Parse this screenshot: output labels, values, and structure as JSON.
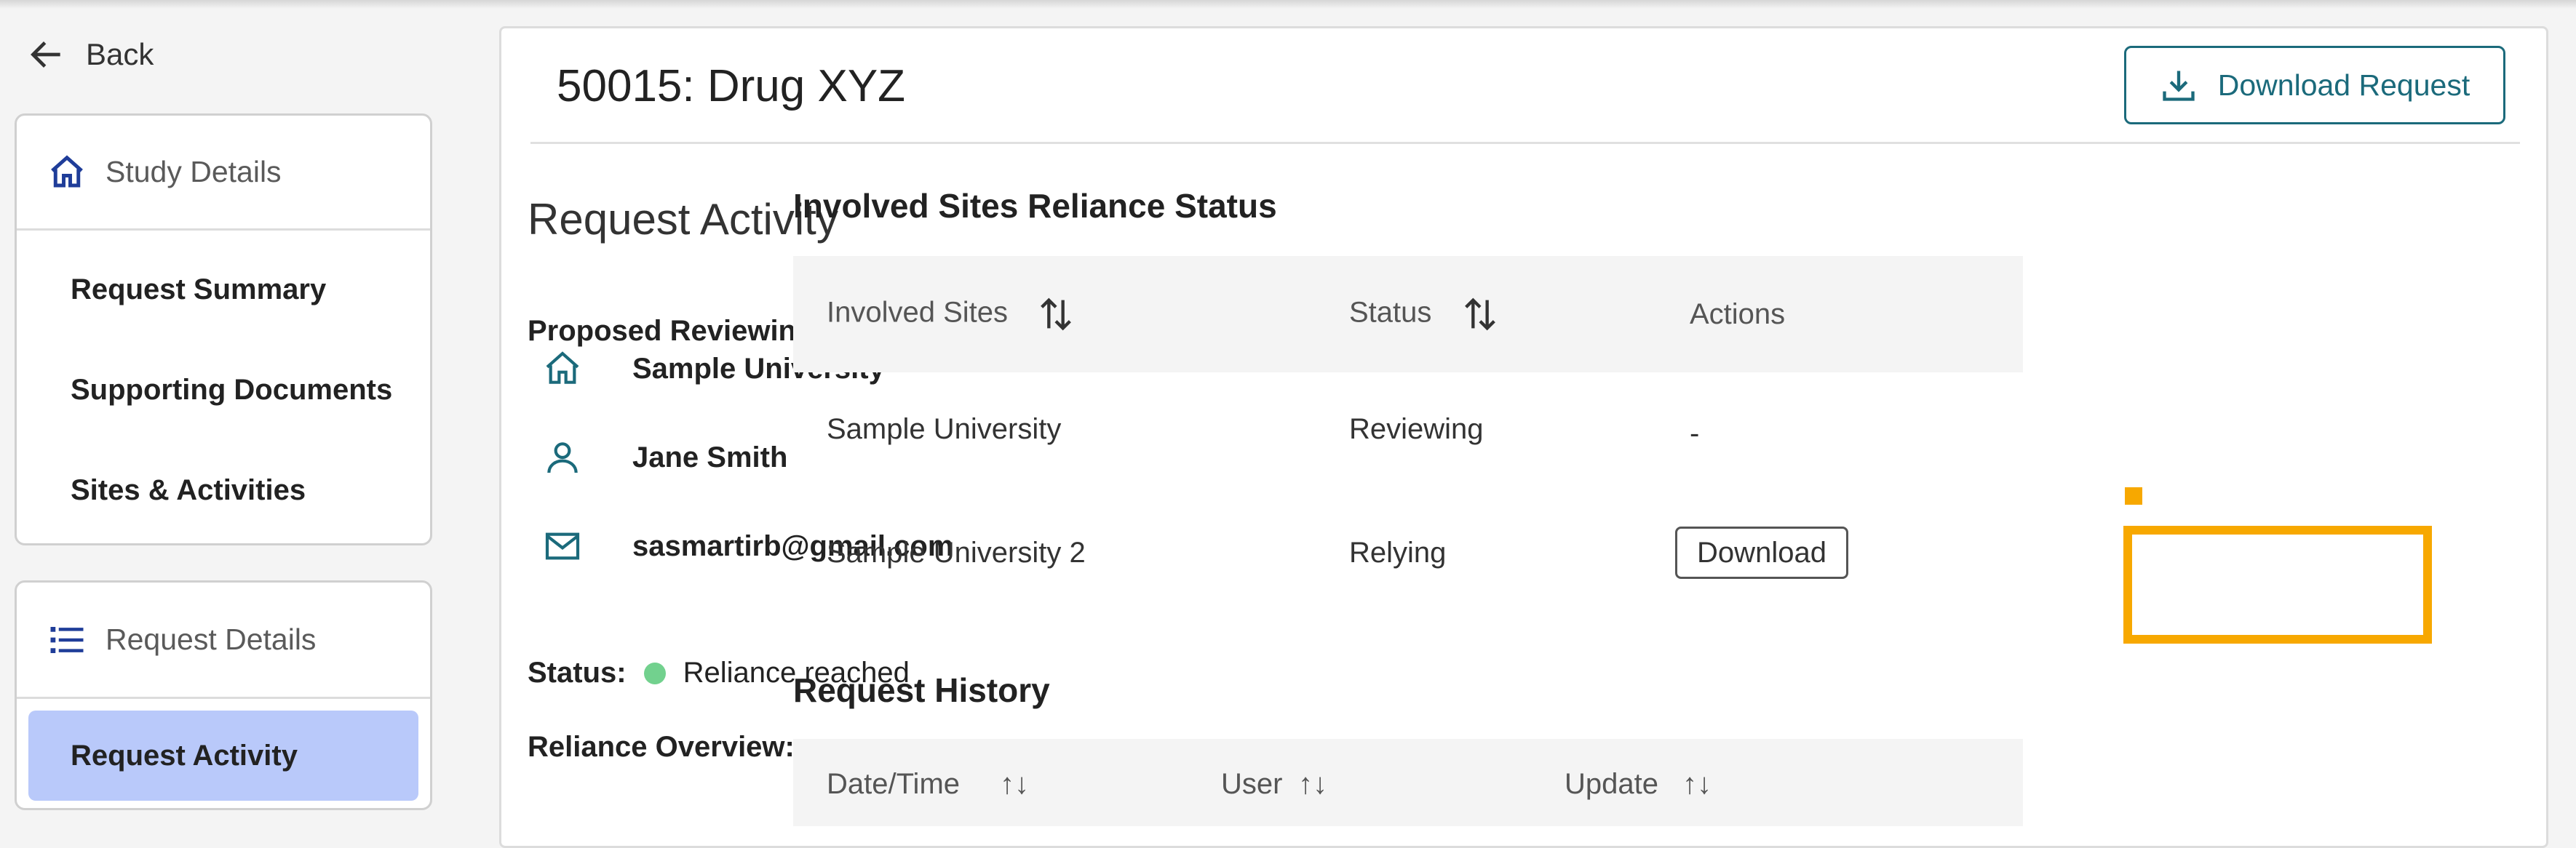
{
  "nav": {
    "back_label": "Back",
    "study_details": {
      "header": "Study Details",
      "items": [
        "Request Summary",
        "Supporting Documents",
        "Sites & Activities"
      ]
    },
    "request_details": {
      "header": "Request Details",
      "items": [
        "Request Activity"
      ]
    }
  },
  "main": {
    "title": "50015: Drug XYZ",
    "download_request_label": "Download Request",
    "section_title": "Request Activity",
    "proposed_irb_label": "Proposed Reviewing IRB:",
    "institution": "Sample University",
    "contact_name": "Jane Smith",
    "contact_email": "sasmartirb@gmail.com",
    "status_label": "Status:",
    "status_value": "Reliance reached",
    "status_color": "#72d18e",
    "reliance_overview_label": "Reliance Overview:"
  },
  "sites": {
    "title": "Involved Sites Reliance Status",
    "columns": [
      "Involved Sites",
      "Status",
      "Actions"
    ],
    "rows": [
      {
        "site": "Sample University",
        "status": "Reviewing",
        "action": "-"
      },
      {
        "site": "Sample University 2",
        "status": "Relying",
        "action": "Download"
      }
    ]
  },
  "history": {
    "title": "Request History",
    "columns": [
      "Date/Time",
      "User",
      "Update"
    ]
  },
  "colors": {
    "accent": "#1b6a7b",
    "active_nav": "#b9c9fa",
    "highlight": "#f7a800",
    "icon_blue": "#1f3d99"
  }
}
